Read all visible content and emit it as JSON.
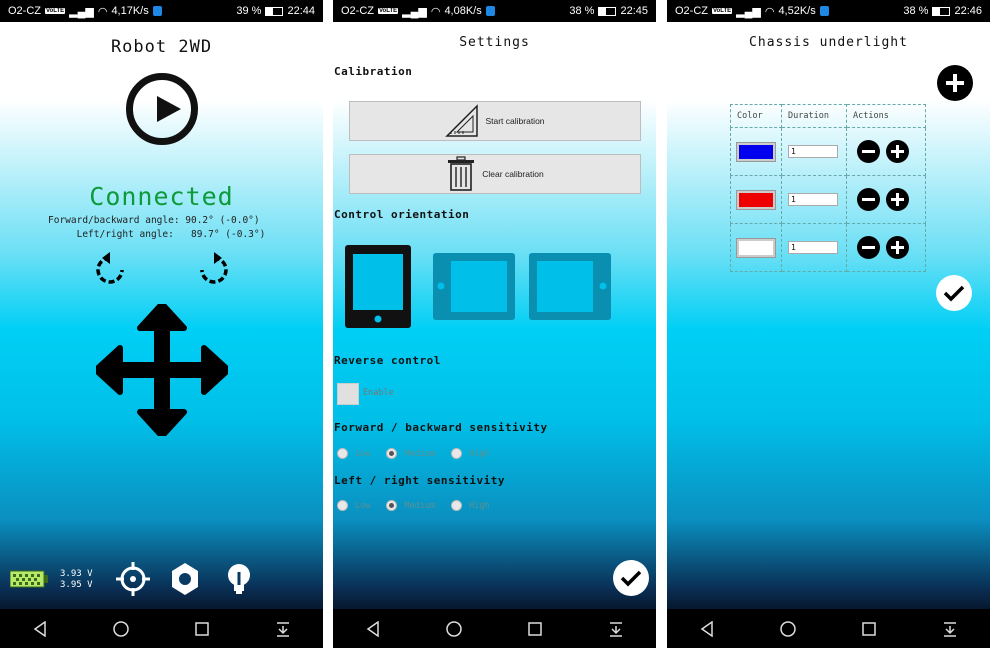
{
  "screens": [
    {
      "status": {
        "carrier": "O2-CZ",
        "volte": "VoLTE",
        "speed": "4,17K/s",
        "battery": "39 %",
        "time": "22:44"
      },
      "title": "Robot 2WD",
      "connection_status": "Connected",
      "angles": "Forward/backward angle: 90.2° (-0.0°)\n     Left/right angle:   89.7° (-0.3°)",
      "voltage1": "3.93 V",
      "voltage2": "3.95 V"
    },
    {
      "status": {
        "carrier": "O2-CZ",
        "volte": "VoLTE",
        "speed": "4,08K/s",
        "battery": "38 %",
        "time": "22:45"
      },
      "title": "Settings",
      "calibration_label": "Calibration",
      "start_calibration": "Start calibration",
      "clear_calibration": "Clear calibration",
      "control_orientation_label": "Control orientation",
      "reverse_control_label": "Reverse control",
      "enable_label": "Enable",
      "fb_sensitivity_label": "Forward / backward sensitivity",
      "lr_sensitivity_label": "Left / right sensitivity",
      "sensitivity_options": [
        "Low",
        "Medium",
        "High"
      ],
      "fb_selected": "Medium",
      "lr_selected": "Medium"
    },
    {
      "status": {
        "carrier": "O2-CZ",
        "volte": "VoLTE",
        "speed": "4,52K/s",
        "battery": "38 %",
        "time": "22:46"
      },
      "title": "Chassis underlight",
      "table_headers": [
        "Color",
        "Duration",
        "Actions"
      ],
      "rows": [
        {
          "color": "#0000ee",
          "duration": "1"
        },
        {
          "color": "#ee0000",
          "duration": "1"
        },
        {
          "color": "#ffffff",
          "duration": "1"
        }
      ]
    }
  ]
}
